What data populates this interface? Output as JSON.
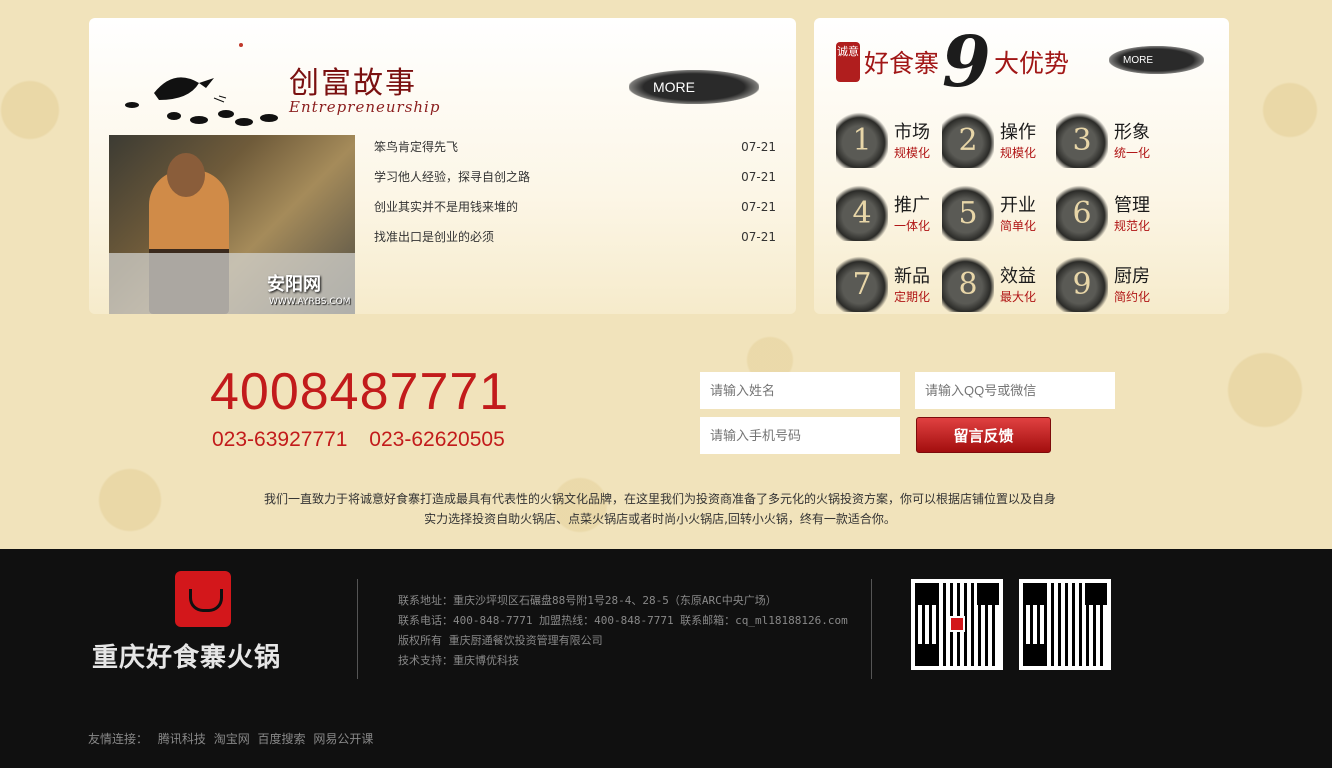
{
  "stories": {
    "title": "创富故事",
    "subtitle": "Entrepreneurship",
    "more_label": "MORE",
    "photo_caption": "安阳网",
    "photo_url": "WWW.AYRBS.COM",
    "items": [
      {
        "title": "笨鸟肯定得先飞",
        "date": "07-21"
      },
      {
        "title": "学习他人经验，探寻自创之路",
        "date": "07-21"
      },
      {
        "title": "创业其实并不是用钱来堆的",
        "date": "07-21"
      },
      {
        "title": "找准出口是创业的必须",
        "date": "07-21"
      }
    ]
  },
  "advantages": {
    "seal": "诚意",
    "brand": "好食寨",
    "nine": "9",
    "tail": "大优势",
    "more_label": "MORE",
    "items": [
      {
        "num": "1",
        "label": "市场",
        "desc": "规模化"
      },
      {
        "num": "2",
        "label": "操作",
        "desc": "规模化"
      },
      {
        "num": "3",
        "label": "形象",
        "desc": "统一化"
      },
      {
        "num": "4",
        "label": "推广",
        "desc": "一体化"
      },
      {
        "num": "5",
        "label": "开业",
        "desc": "简单化"
      },
      {
        "num": "6",
        "label": "管理",
        "desc": "规范化"
      },
      {
        "num": "7",
        "label": "新品",
        "desc": "定期化"
      },
      {
        "num": "8",
        "label": "效益",
        "desc": "最大化"
      },
      {
        "num": "9",
        "label": "厨房",
        "desc": "简约化"
      }
    ]
  },
  "contact": {
    "hotline": "4008487771",
    "phones": "023-63927771   023-62620505"
  },
  "form": {
    "name_placeholder": "请输入姓名",
    "qq_placeholder": "请输入QQ号或微信",
    "phone_placeholder": "请输入手机号码",
    "submit_label": "留言反馈"
  },
  "intro": {
    "line1": "我们一直致力于将诚意好食寨打造成最具有代表性的火锅文化品牌，在这里我们为投资商准备了多元化的火锅投资方案，你可以根据店铺位置以及自身",
    "line2": "实力选择投资自助火锅店、点菜火锅店或者时尚小火锅店,回转小火锅，终有一款适合你。"
  },
  "footer": {
    "logo_text": "重庆好食寨火锅",
    "address": "联系地址：重庆沙坪坝区石碾盘88号附1号28-4、28-5（东原ARC中央广场）",
    "phone": "联系电话：400-848-7771 加盟热线：400-848-7771 联系邮箱：cq_ml18188126.com",
    "copyright": "版权所有 重庆厨通餐饮投资管理有限公司",
    "support": "技术支持：重庆博优科技",
    "friend_label": "友情连接：",
    "friend_links": [
      "腾讯科技",
      "淘宝网",
      "百度搜索",
      "网易公开课"
    ]
  },
  "colors": {
    "background": "#f1e3bb",
    "accent_red": "#c21b1b",
    "footer_bg": "#101010"
  }
}
